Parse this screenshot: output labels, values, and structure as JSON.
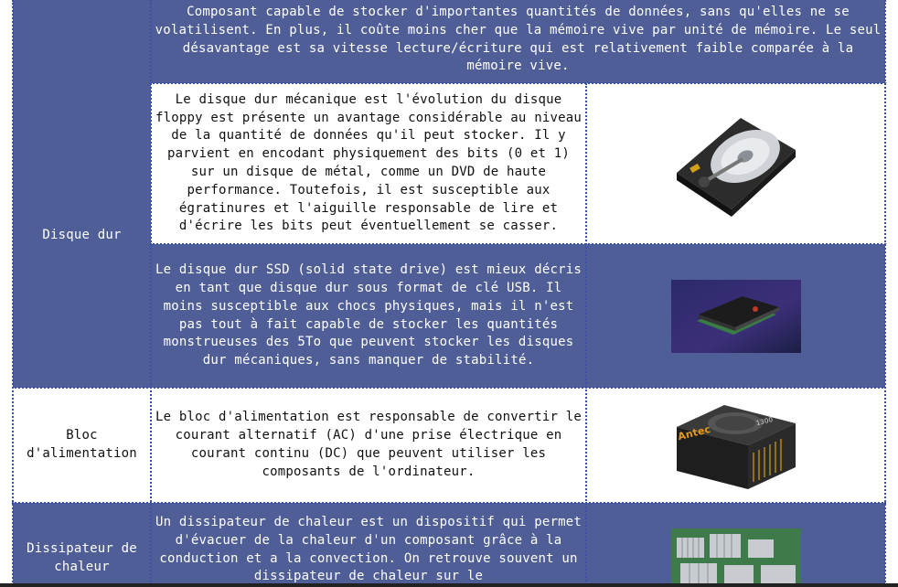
{
  "rows": {
    "memory_desc": "Composant capable de stocker d'importantes quantités de données, sans qu'elles ne se volatilisent. En plus, il coûte moins cher que la mémoire vive par unité de mémoire. Le seul désavantage est sa vitesse lecture/écriture qui est relativement faible comparée à la mémoire vive.",
    "hdd_label": "Disque dur",
    "hdd_desc": "Le disque dur mécanique est l'évolution du disque floppy est présente un avantage considérable au niveau de la quantité de données qu'il peut stocker. Il y parvient en encodant physiquement des bits (0 et 1) sur un disque de métal, comme un DVD de haute performance. Toutefois, il est susceptible aux égratinures et l'aiguille responsable de lire et d'écrire les bits peut éventuellement se casser.",
    "ssd_desc": "Le disque dur SSD (solid state drive) est mieux décris en tant que disque dur sous format de clé USB. Il moins susceptible aux chocs physiques, mais il n'est pas tout à fait capable de stocker les quantités monstrueuses des 5To que peuvent stocker les disques dur mécaniques, sans manquer de stabilité.",
    "psu_label": "Bloc d'alimentation",
    "psu_desc": "Le bloc d'alimentation est responsable de convertir le courant alternatif (AC) d'une prise électrique en courant continu (DC) que peuvent utiliser les composants de l'ordinateur.",
    "psu_brand": "Antec",
    "psu_model": "1300",
    "heatsink_label": "Dissipateur de chaleur",
    "heatsink_desc": "Un dissipateur de chaleur est un dispositif qui permet d'évacuer de la chaleur d'un composant grâce à la conduction et a la convection. On retrouve souvent un dissipateur de chaleur sur le"
  },
  "colors": {
    "row_blue": "#4f5e96",
    "row_white": "#ffffff",
    "grid_dotted": "#3a4fa8"
  },
  "icons": [
    "hard-disk-image",
    "ssd-image",
    "power-supply-image",
    "heatsink-image"
  ]
}
